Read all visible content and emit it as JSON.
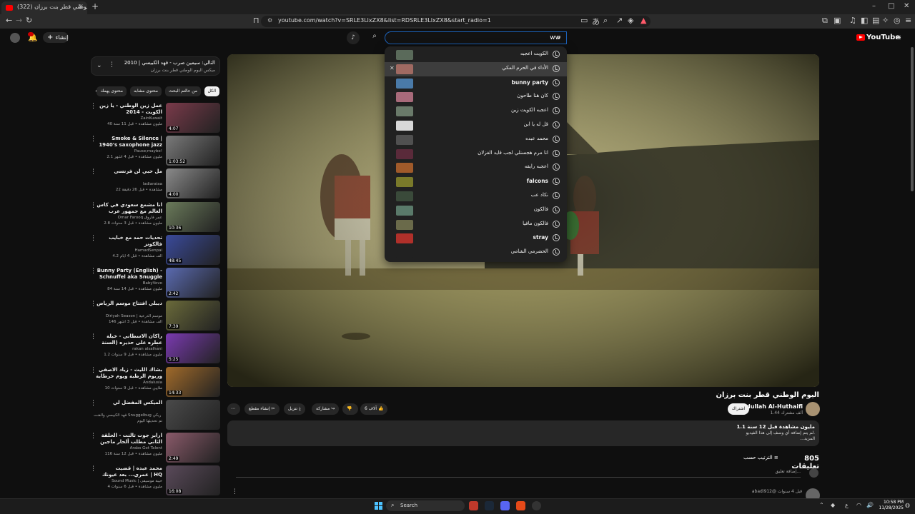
{
  "browser": {
    "tab_title": "(322) اليوم الوطني قطر بنت برزان",
    "url": "youtube.com/watch?v=SRLE3LlxZX8&list=RDSRLE3LlxZX8&start_radio=1"
  },
  "header": {
    "logo": "YouTube",
    "create_label": "إنشاء",
    "search_value": "ww",
    "search_placeholder": "بحث"
  },
  "suggestions": [
    {
      "text": "الكويت اعجبه",
      "bold": false,
      "thumb_color": "#5a6a5a"
    },
    {
      "text": "الأداء في الحرم المكي",
      "bold": false,
      "thumb_color": "#a06a62",
      "hover": true
    },
    {
      "text": "bunny party",
      "bold": true,
      "thumb_color": "#4a7aa8"
    },
    {
      "text": "كان هنا طاحون",
      "bold": false,
      "thumb_color": "#a86a7a"
    },
    {
      "text": "اعجبه الكويت زين",
      "bold": false,
      "thumb_color": "#6a7a6a"
    },
    {
      "text": "قل له يا ابن",
      "bold": false,
      "thumb_color": "#d8d8d8"
    },
    {
      "text": "محمد عبده",
      "bold": false,
      "thumb_color": "#505050"
    },
    {
      "text": "انا مرم هجسنلي لجب قايد الغزلان",
      "bold": false,
      "thumb_color": "#5a2a3a"
    },
    {
      "text": "اعجبه رايقه",
      "bold": false,
      "thumb_color": "#a05a2a"
    },
    {
      "text": "falcons",
      "bold": true,
      "thumb_color": "#7a7a2a"
    },
    {
      "text": "نكاد عب",
      "bold": false,
      "thumb_color": "#3a4a3a"
    },
    {
      "text": "فالكون",
      "bold": false,
      "thumb_color": "#5a7a6a"
    },
    {
      "text": "فالكون مافيا",
      "bold": false,
      "thumb_color": "#6a6a4a"
    },
    {
      "text": "stray",
      "bold": true,
      "thumb_color": "#b0302a"
    },
    {
      "text": "الحضرمي الشامي",
      "bold": false,
      "thumb_color": "#212121"
    }
  ],
  "playlist": {
    "title": "التالي: سيمين صرب - فهد الكبيسي | 2010",
    "subtitle": "ميكس اليوم الوطني قطر بنت برزان"
  },
  "chips": [
    {
      "label": "الكل",
      "active": true
    },
    {
      "label": "من حالتم البحث",
      "active": false
    },
    {
      "label": "محتوى مشابه",
      "active": false
    },
    {
      "label": "محتوى يهمك",
      "active": false
    }
  ],
  "recommendations": [
    {
      "title": "عمل زين الوطني - يا زين الكويت - 2014",
      "channel": "ZainKuwait",
      "meta": "40 مليون مشاهدة • قبل 11 سنة",
      "duration": "4:07",
      "thumb": "#7a3a4a"
    },
    {
      "title": "Smoke & Silence | 1940's saxophone jazz",
      "channel": "Pause;maybe!",
      "meta": "2.1 مليون مشاهدة • قبل 4 أشهر",
      "duration": "1:03:52",
      "thumb": "#7a7a7a"
    },
    {
      "title": "مل حبي لن فرنسي",
      "channel": "ladiaraiaa",
      "meta": "22 مشاهدة • قبل 26 دقيقة",
      "duration": "4:00",
      "thumb": "#8a8a8a"
    },
    {
      "title": "انا مشمع سعودي في كاس العالم مع جمهور عرب",
      "channel": "Omar Farooq عمر فاروق",
      "meta": "2.8 مليون مشاهدة • قبل 3 سنوات",
      "duration": "10:36",
      "thumb": "#6a7a5a"
    },
    {
      "title": "تحديات حمد مع خبايب فالكونز",
      "channel": "HamadSenpai",
      "meta": "4.2 ألف مشاهدة • قبل 4 أيام",
      "duration": "48:45",
      "thumb": "#3a4a9a"
    },
    {
      "title": "Bunny Party (English) - Schnuffel aka Snuggle Bunny",
      "channel": "BabyVovo",
      "meta": "84 مليون مشاهدة • قبل 14 سنة",
      "duration": "2:42",
      "thumb": "#5a6ab0"
    },
    {
      "title": "ديبلي افتتاح موسم الرياض",
      "channel": "Diriyah Season | موسم الدرعية",
      "meta": "146 ألف مشاهدة • قبل 3 أشهر",
      "duration": "7:39",
      "thumb": "#6a6a3a"
    },
    {
      "title": "راكان الاسطاني - خيلة عطره على حذيره (السنة الأساسية) | 2016",
      "channel": "rakan alsalhani",
      "meta": "1.2 مليون مشاهدة • قبل 9 سنوات",
      "duration": "5:25",
      "thumb": "#7a3ab0"
    },
    {
      "title": "بشاك الليث - زياد الاصفي وريوم الرطبة ويوم خرطاية - الاعلي - Andalusia",
      "channel": "Andalusia",
      "meta": "10 ملايين مشاهدة • قبل 9 سنوات",
      "duration": "14:33",
      "thumb": "#a06a2a"
    },
    {
      "title": "الميكس المفضل لي",
      "channel": "فهد الكبيسي والفنت Snuggelbug وشكو ريكي",
      "meta": "تم تحديثها اليوم",
      "duration": "",
      "thumb": "#4a4a4a"
    },
    {
      "title": "آرابز جوت تالنت - الحلقة الثاني مطلب ألحار ماجين المشتاعين في Arabs Got talent",
      "channel": "Arabs Got Talent",
      "meta": "116 مليون مشاهدة • قبل 12 سنة",
      "duration": "2:49",
      "thumb": "#8a5a6a"
    },
    {
      "title": "محمد عبده | قضيت عمري... بعد عيونك | HQ",
      "channel": "Sound Music | خيبة موسيقى",
      "meta": "4 مليون مشاهدة • قبل 6 سنوات",
      "duration": "16:08",
      "thumb": "#5a4a5a"
    }
  ],
  "video": {
    "title": "اليوم الوطني قطر بنت برزان",
    "channel": "Abdullah Al-Huthaifi",
    "subscribers": "1.44 ألف مشترك",
    "subscribe_label": "اشتراك",
    "likes": "6 آلاف",
    "share_label": "مشاركة",
    "download_label": "تنزيل",
    "clip_label": "إنشاء مقطع",
    "views": "1.1 مليون مشاهدة قبل 12 سنة",
    "description": "لم يتم إضافة أي وصف إلى هذا الفيديو.",
    "more_label": "...المزيد"
  },
  "comments": {
    "count": "805 تعليقات",
    "sort_label": "الترتيب حسب",
    "input_placeholder": "إضافة تعليق...",
    "first": "abadi912@ قبل 4 سنوات"
  },
  "taskbar": {
    "search_label": "Search",
    "time": "10:58 PM",
    "date": "11/28/2025"
  }
}
